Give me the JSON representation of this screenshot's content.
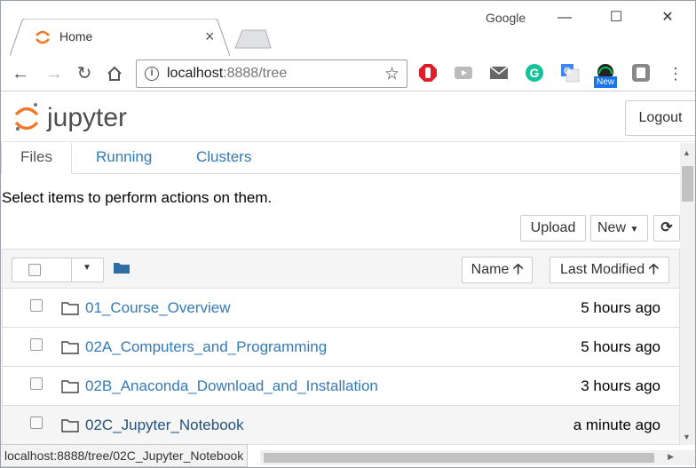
{
  "browser": {
    "brand": "Google",
    "tab_title": "Home",
    "url_host": "localhost",
    "url_path": ":8888/tree",
    "window_controls": {
      "minimize": "—",
      "maximize": "☐",
      "close": "✕"
    },
    "extensions": [
      "adblock-icon",
      "youtube-icon",
      "mail-icon",
      "grammarly-icon",
      "translate-icon",
      "speedometer-icon",
      "screencast-icon"
    ],
    "new_badge": "New"
  },
  "jupyter": {
    "logo_text": "jupyter",
    "logout_label": "Logout",
    "tabs": [
      {
        "label": "Files",
        "active": true
      },
      {
        "label": "Running",
        "active": false
      },
      {
        "label": "Clusters",
        "active": false
      }
    ],
    "hint": "Select items to perform actions on them.",
    "upload_label": "Upload",
    "new_label": "New",
    "sort_name_label": "Name",
    "sort_modified_label": "Last Modified",
    "items": [
      {
        "name": "01_Course_Overview",
        "modified": "5 hours ago"
      },
      {
        "name": "02A_Computers_and_Programming",
        "modified": "5 hours ago"
      },
      {
        "name": "02B_Anaconda_Download_and_Installation",
        "modified": "3 hours ago"
      },
      {
        "name": "02C_Jupyter_Notebook",
        "modified": "a minute ago"
      }
    ]
  },
  "status_url": "localhost:8888/tree/02C_Jupyter_Notebook",
  "colors": {
    "link": "#337ab7",
    "jupyter_orange": "#f37726",
    "folder_blue": "#2e6da4"
  }
}
